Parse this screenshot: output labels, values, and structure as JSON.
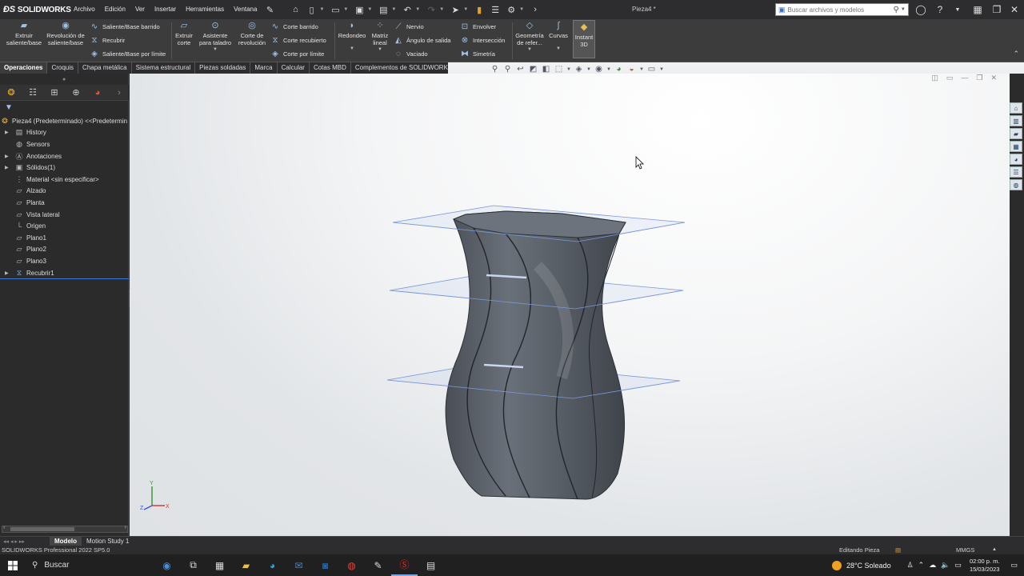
{
  "app": {
    "brand": "SOLIDWORKS",
    "document_title": "Pieza4 *",
    "status_left": "SOLIDWORKS Professional 2022 SP5.0",
    "status_mode": "Editando Pieza",
    "status_units": "MMGS"
  },
  "menu": [
    "Archivo",
    "Edición",
    "Ver",
    "Insertar",
    "Herramientas",
    "Ventana"
  ],
  "search": {
    "placeholder": "Buscar archivos y modelos"
  },
  "ribbon": {
    "extrude": "Extruir saliente/base",
    "revolve": "Revolución de saliente/base",
    "sweep": "Saliente/Base barrido",
    "loft": "Recubrir",
    "boundary": "Saliente/Base por límite",
    "cut_extrude": "Extruir corte",
    "hole_wizard": "Asistente para taladro",
    "cut_revolve": "Corte de revolución",
    "cut_sweep": "Corte barrido",
    "cut_loft": "Corte recubierto",
    "cut_boundary": "Corte por límite",
    "fillet": "Redondeo",
    "linear_pattern": "Matriz lineal",
    "rib": "Nervio",
    "draft": "Ángulo de salida",
    "shell": "Vaciado",
    "wrap": "Envolver",
    "intersect": "Intersección",
    "mirror": "Simetría",
    "ref_geometry": "Geometría de refer...",
    "curves": "Curvas",
    "instant3d": "Instant 3D"
  },
  "command_tabs": [
    "Operaciones",
    "Croquis",
    "Chapa metálica",
    "Sistema estructural",
    "Piezas soldadas",
    "Marca",
    "Calcular",
    "Cotas MBD",
    "Complementos de SOLIDWORKS"
  ],
  "tree": {
    "root": "Pieza4 (Predeterminado) <<Predetermin",
    "items": [
      {
        "label": "History",
        "expandable": true
      },
      {
        "label": "Sensors",
        "expandable": false
      },
      {
        "label": "Anotaciones",
        "expandable": true
      },
      {
        "label": "Sólidos(1)",
        "expandable": true
      },
      {
        "label": "Material <sin especificar>",
        "expandable": false
      },
      {
        "label": "Alzado",
        "expandable": false
      },
      {
        "label": "Planta",
        "expandable": false
      },
      {
        "label": "Vista lateral",
        "expandable": false
      },
      {
        "label": "Origen",
        "expandable": false
      },
      {
        "label": "Plano1",
        "expandable": false
      },
      {
        "label": "Plano2",
        "expandable": false
      },
      {
        "label": "Plano3",
        "expandable": false
      },
      {
        "label": "Recubrir1",
        "expandable": true
      }
    ]
  },
  "bottom_tabs": [
    "Modelo",
    "Motion Study 1"
  ],
  "taskbar": {
    "search_label": "Buscar",
    "weather": "28°C Soleado",
    "time": "02:00 p. m.",
    "date": "15/03/2023"
  },
  "colors": {
    "accent": "#3d7bd6",
    "model": "#5b616a",
    "plane": "#6f8fd6"
  }
}
